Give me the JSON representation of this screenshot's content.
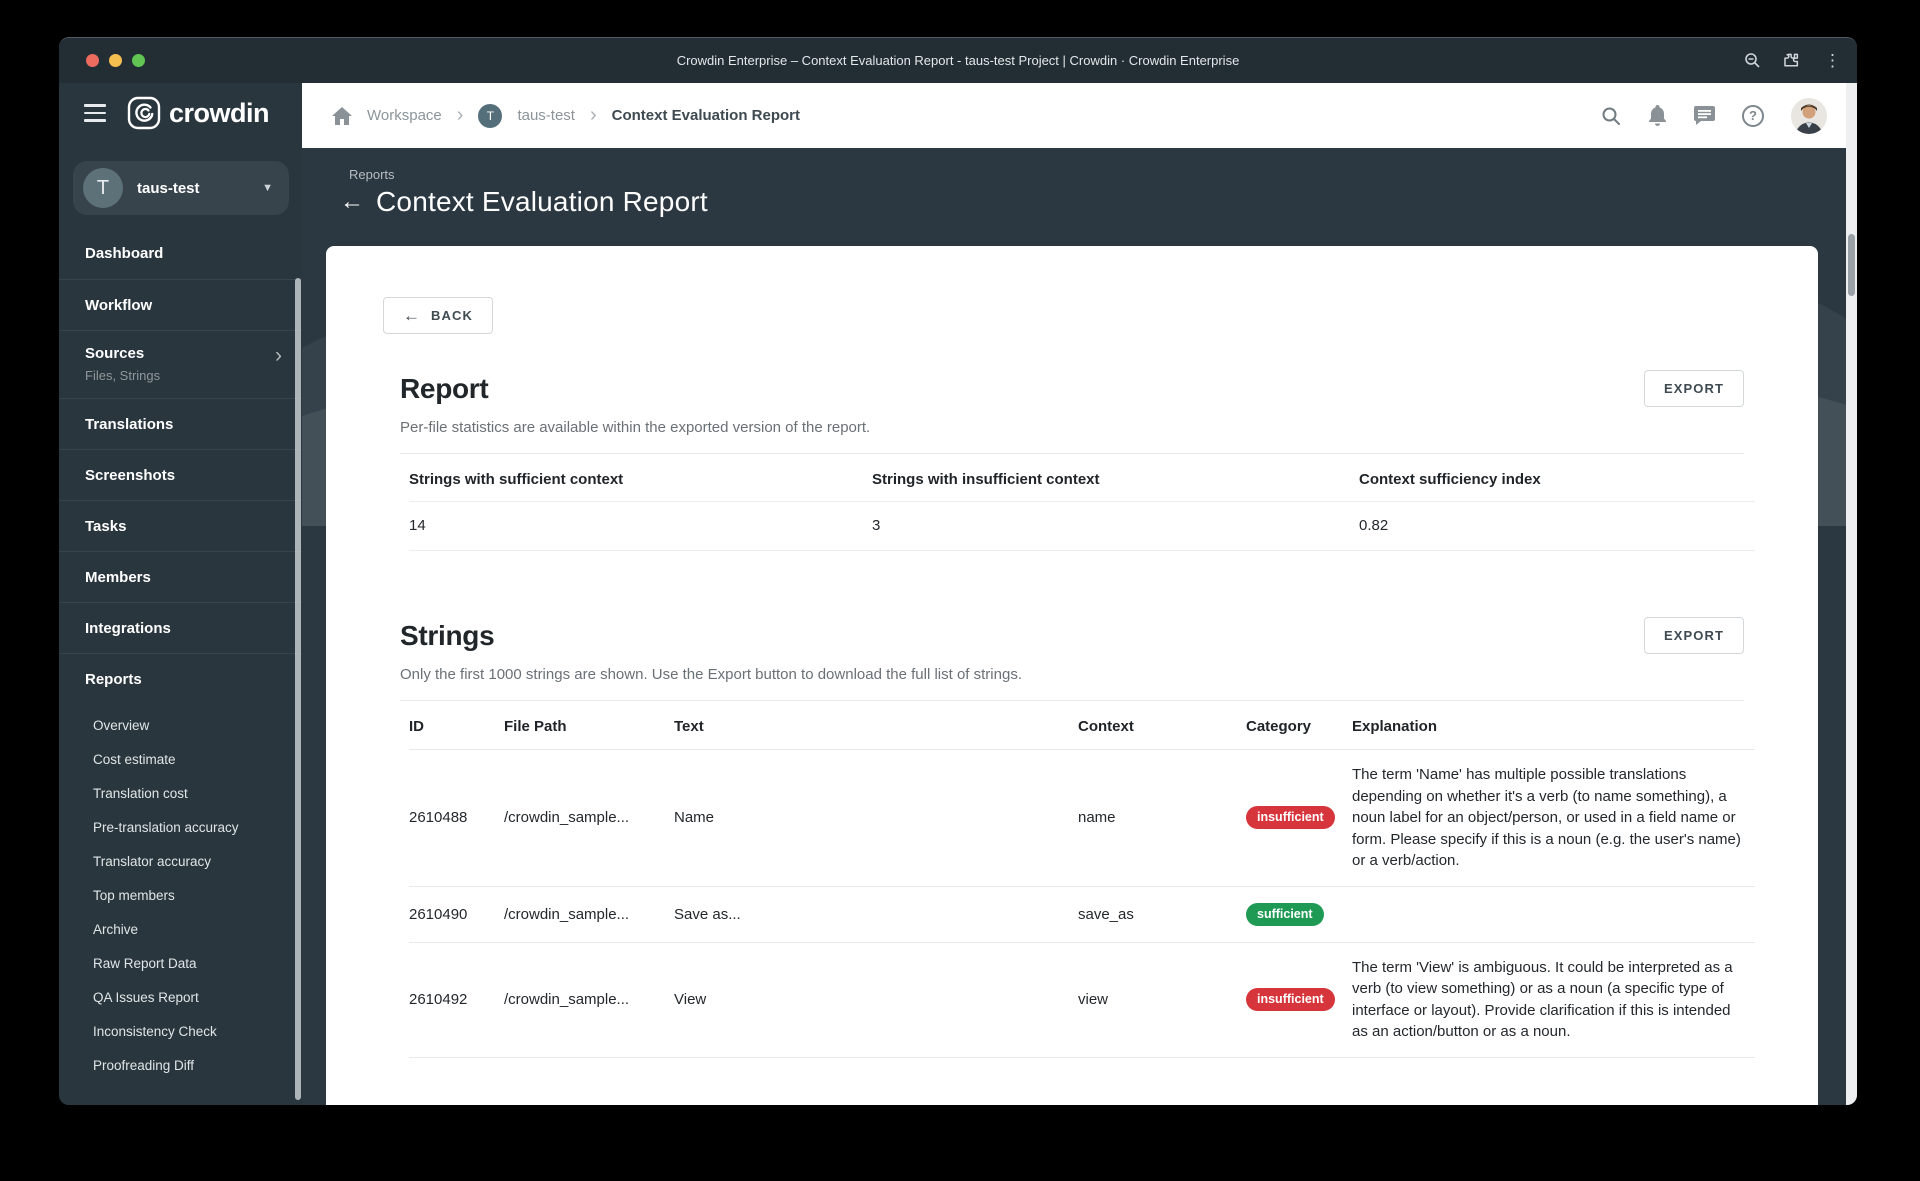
{
  "browser": {
    "title": "Crowdin Enterprise – Context Evaluation Report - taus-test Project | Crowdin · Crowdin Enterprise"
  },
  "appbar": {
    "breadcrumb": {
      "workspace": "Workspace",
      "project_initial": "T",
      "project": "taus-test",
      "current": "Context Evaluation Report"
    }
  },
  "sidebar": {
    "logo": "crowdin",
    "project": {
      "initial": "T",
      "name": "taus-test"
    },
    "items": [
      {
        "label": "Dashboard"
      },
      {
        "label": "Workflow"
      },
      {
        "label": "Sources",
        "sublabel": "Files, Strings"
      },
      {
        "label": "Translations"
      },
      {
        "label": "Screenshots"
      },
      {
        "label": "Tasks"
      },
      {
        "label": "Members"
      },
      {
        "label": "Integrations"
      },
      {
        "label": "Reports"
      }
    ],
    "report_items": [
      "Overview",
      "Cost estimate",
      "Translation cost",
      "Pre-translation accuracy",
      "Translator accuracy",
      "Top members",
      "Archive",
      "Raw Report Data",
      "QA Issues Report",
      "Inconsistency Check",
      "Proofreading Diff"
    ]
  },
  "hero": {
    "eyebrow": "Reports",
    "title": "Context Evaluation Report"
  },
  "report": {
    "back": "BACK",
    "title": "Report",
    "subtitle": "Per-file statistics are available within the exported version of the report.",
    "export": "EXPORT",
    "stats_headers": [
      "Strings with sufficient context",
      "Strings with insufficient context",
      "Context sufficiency index"
    ],
    "stats_values": [
      "14",
      "3",
      "0.82"
    ]
  },
  "strings": {
    "title": "Strings",
    "subtitle": "Only the first 1000 strings are shown. Use the Export button to download the full list of strings.",
    "export": "EXPORT",
    "headers": [
      "ID",
      "File Path",
      "Text",
      "Context",
      "Category",
      "Explanation"
    ],
    "rows": [
      {
        "id": "2610488",
        "file_path": "/crowdin_sample...",
        "text": "Name",
        "context": "name",
        "category": "insufficient",
        "explanation": "The term 'Name' has multiple possible translations depending on whether it's a verb (to name something), a noun label for an object/person, or used in a field name or form. Please specify if this is a noun (e.g. the user's name) or a verb/action."
      },
      {
        "id": "2610490",
        "file_path": "/crowdin_sample...",
        "text": "Save as...",
        "context": "save_as",
        "category": "sufficient",
        "explanation": ""
      },
      {
        "id": "2610492",
        "file_path": "/crowdin_sample...",
        "text": "View",
        "context": "view",
        "category": "insufficient",
        "explanation": "The term 'View' is ambiguous. It could be interpreted as a verb (to view something) or as a noun (a specific type of interface or layout). Provide clarification if this is intended as an action/button or as a noun."
      }
    ]
  },
  "colors": {
    "badge_insufficient": "#d6353c",
    "badge_sufficient": "#1f9a55",
    "sidebar_bg": "#2a363d",
    "hero_bg": "#2b3841"
  }
}
